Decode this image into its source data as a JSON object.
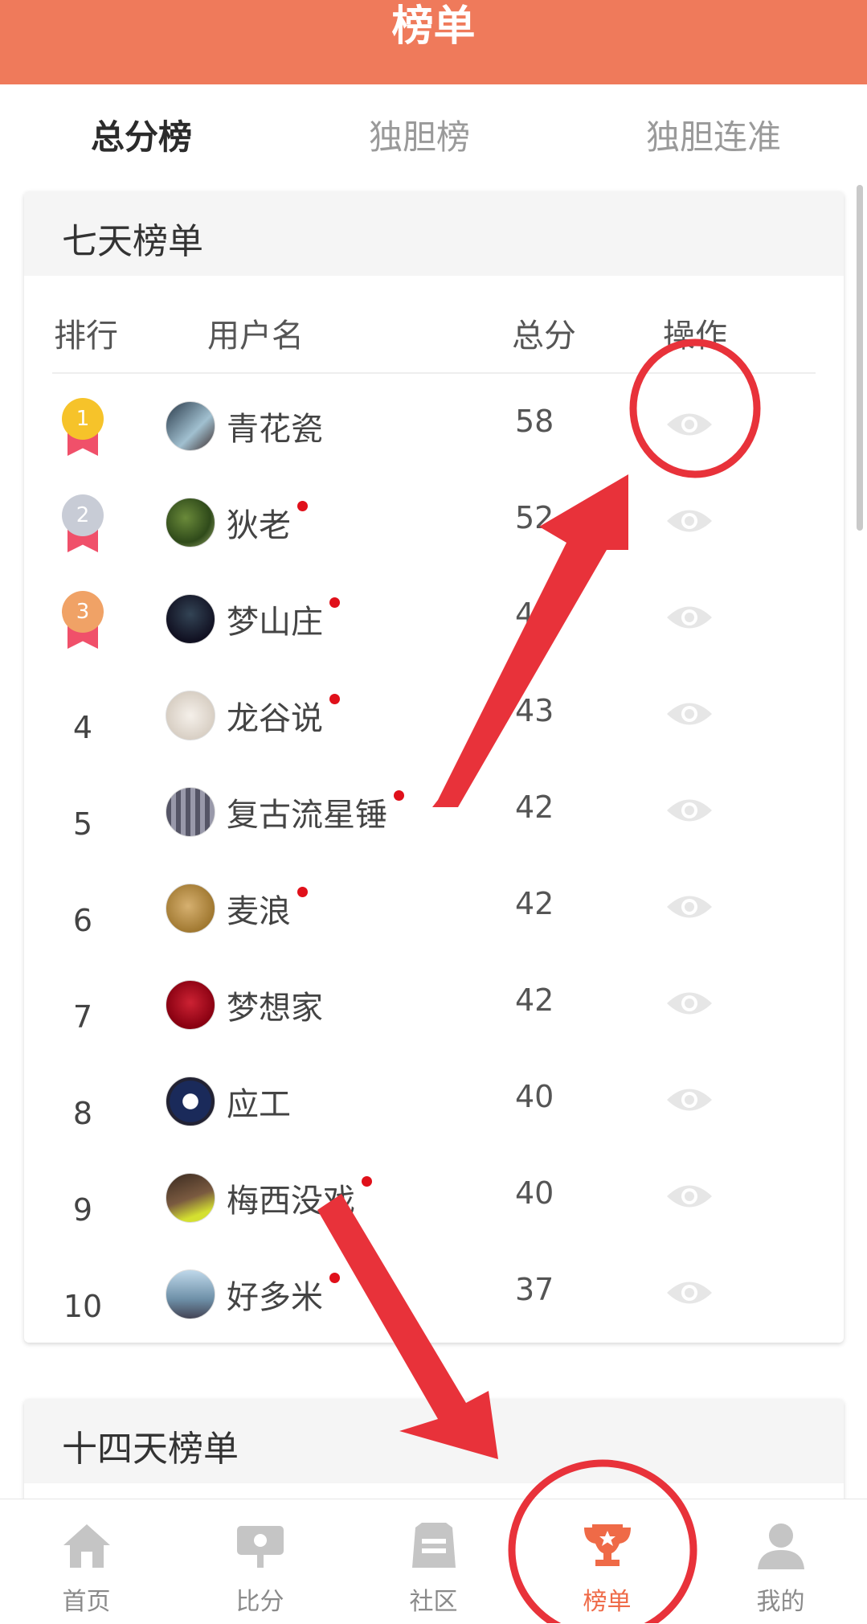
{
  "header": {
    "title": "榜单"
  },
  "tabs": [
    {
      "label": "总分榜",
      "active": true
    },
    {
      "label": "独胆榜",
      "active": false
    },
    {
      "label": "独胆连准",
      "active": false
    }
  ],
  "seven_day": {
    "title": "七天榜单",
    "columns": {
      "rank": "排行",
      "user": "用户名",
      "score": "总分",
      "action": "操作"
    },
    "rows": [
      {
        "rank": "1",
        "name": "青花瓷",
        "score": "58",
        "online": false,
        "medal": "gold"
      },
      {
        "rank": "2",
        "name": "狄老",
        "score": "52",
        "online": true,
        "medal": "silver"
      },
      {
        "rank": "3",
        "name": "梦山庄",
        "score": "4",
        "online": true,
        "medal": "bronze"
      },
      {
        "rank": "4",
        "name": "龙谷说",
        "score": "43",
        "online": true
      },
      {
        "rank": "5",
        "name": "复古流星锤",
        "score": "42",
        "online": true
      },
      {
        "rank": "6",
        "name": "麦浪",
        "score": "42",
        "online": true
      },
      {
        "rank": "7",
        "name": "梦想家",
        "score": "42",
        "online": false
      },
      {
        "rank": "8",
        "name": "应工",
        "score": "40",
        "online": false
      },
      {
        "rank": "9",
        "name": "梅西没戏",
        "score": "40",
        "online": true
      },
      {
        "rank": "10",
        "name": "好多米",
        "score": "37",
        "online": true
      }
    ]
  },
  "fourteen_day": {
    "title": "十四天榜单"
  },
  "bottom_nav": [
    {
      "label": "首页",
      "icon": "home-icon"
    },
    {
      "label": "比分",
      "icon": "scoreboard-icon"
    },
    {
      "label": "社区",
      "icon": "community-icon"
    },
    {
      "label": "榜单",
      "icon": "trophy-icon",
      "active": true
    },
    {
      "label": "我的",
      "icon": "profile-icon"
    }
  ],
  "colors": {
    "brand": "#ef7a5b",
    "active_nav": "#ef6a47",
    "annotation": "#e8323a",
    "online_dot": "#e0101a"
  }
}
